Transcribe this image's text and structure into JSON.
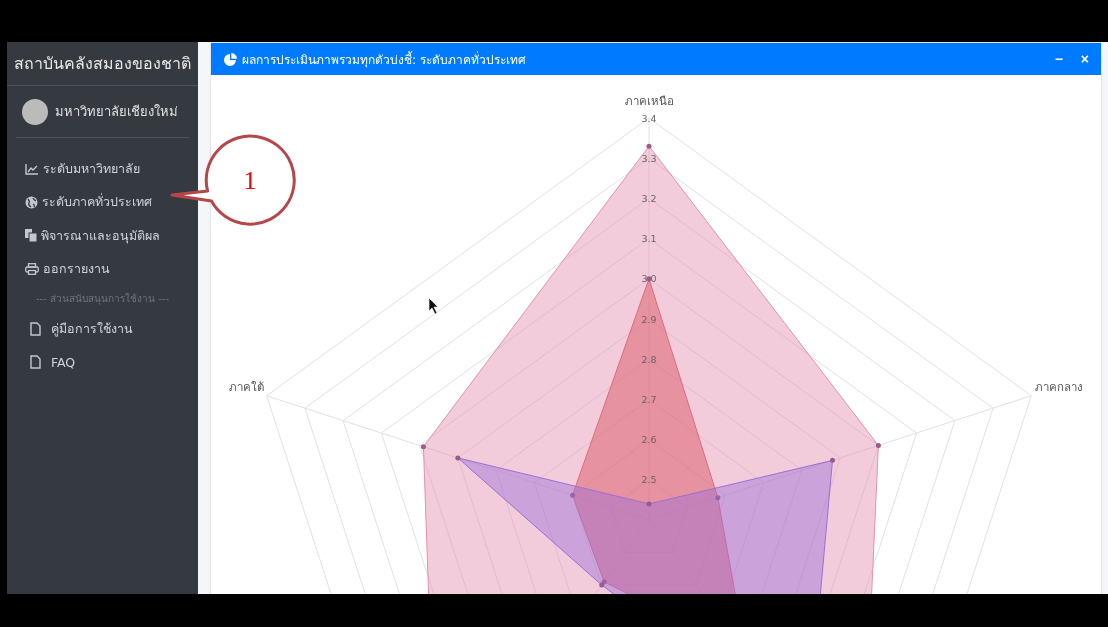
{
  "sidebar": {
    "brand": "สถาบันคลังสมองของชาติ",
    "user": {
      "name": "มหาวิทยาลัยเชียงใหม่"
    },
    "items": [
      {
        "kind": "chart",
        "label": "ระดับมหาวิทยาลัย"
      },
      {
        "kind": "globe",
        "label": "ระดับภาคทั่วประเทศ"
      },
      {
        "kind": "copy",
        "label": "พิจารณาและอนุมัติผล"
      },
      {
        "kind": "print",
        "label": "ออกรายงาน"
      }
    ],
    "section_header": "--- ส่วนสนับสนุนการใช้งาน ---",
    "support_items": [
      {
        "kind": "file",
        "label": "คู่มือการใช้งาน"
      },
      {
        "kind": "file",
        "label": "FAQ"
      }
    ]
  },
  "callout": {
    "text": "1"
  },
  "panel": {
    "title": "ผลการประเมินภาพรวมทุกตัวบ่งชี้: ระดับภาคทั่วประเทศ",
    "tools": [
      "−",
      "×"
    ],
    "radar_chart": {
      "axis_labels": [
        "ภาคเหนือ",
        "ภาคกลาง",
        "ภาคใต้"
      ],
      "tick_labels": [
        "3.4",
        "3.3",
        "3.2",
        "3.1",
        "3.0",
        "2.9",
        "2.8",
        "2.7",
        "2.6",
        "2.5"
      ]
    }
  }
}
